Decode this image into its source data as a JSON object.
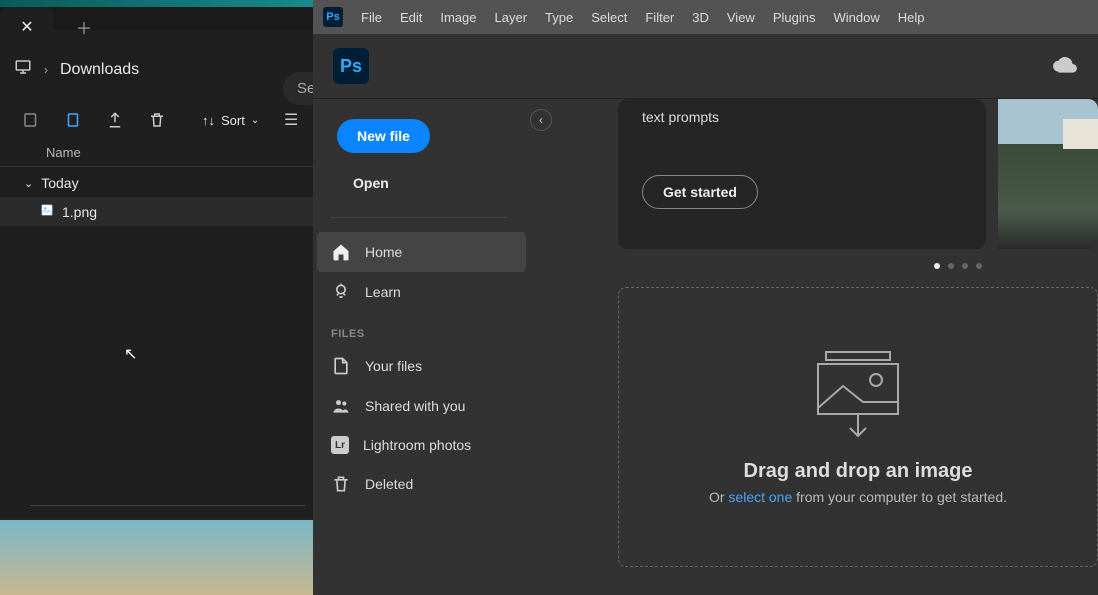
{
  "explorer": {
    "path_label": "Downloads",
    "search_placeholder": "Sea",
    "sort_label": "Sort",
    "name_col": "Name",
    "group": "Today",
    "file": "1.png"
  },
  "ps": {
    "menus": [
      "File",
      "Edit",
      "Image",
      "Layer",
      "Type",
      "Select",
      "Filter",
      "3D",
      "View",
      "Plugins",
      "Window",
      "Help"
    ],
    "logo_text": "Ps",
    "new_file": "New file",
    "open": "Open",
    "nav_home": "Home",
    "nav_learn": "Learn",
    "section_files": "FILES",
    "nav_yourfiles": "Your files",
    "nav_shared": "Shared with you",
    "nav_lightroom": "Lightroom photos",
    "nav_deleted": "Deleted",
    "promo_text": "text prompts",
    "get_started": "Get started",
    "drop_title": "Drag and drop an image",
    "drop_or": "Or ",
    "drop_link": "select one",
    "drop_rest": " from your computer to get started."
  }
}
